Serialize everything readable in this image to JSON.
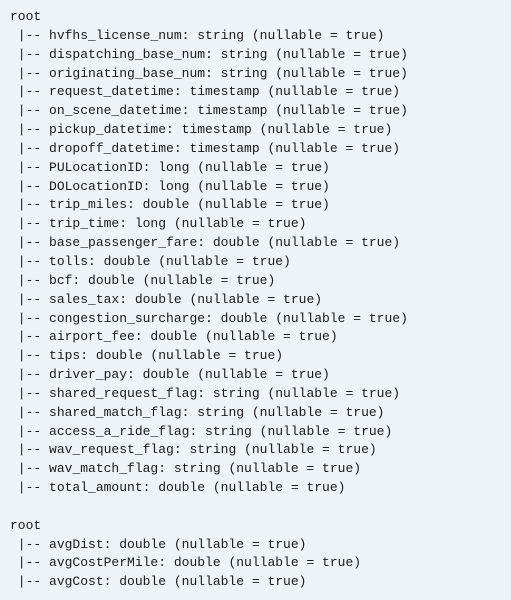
{
  "schemas": [
    {
      "label": "root",
      "fields": [
        {
          "name": "hvfhs_license_num",
          "type": "string",
          "nullable": true
        },
        {
          "name": "dispatching_base_num",
          "type": "string",
          "nullable": true
        },
        {
          "name": "originating_base_num",
          "type": "string",
          "nullable": true
        },
        {
          "name": "request_datetime",
          "type": "timestamp",
          "nullable": true
        },
        {
          "name": "on_scene_datetime",
          "type": "timestamp",
          "nullable": true
        },
        {
          "name": "pickup_datetime",
          "type": "timestamp",
          "nullable": true
        },
        {
          "name": "dropoff_datetime",
          "type": "timestamp",
          "nullable": true
        },
        {
          "name": "PULocationID",
          "type": "long",
          "nullable": true
        },
        {
          "name": "DOLocationID",
          "type": "long",
          "nullable": true
        },
        {
          "name": "trip_miles",
          "type": "double",
          "nullable": true
        },
        {
          "name": "trip_time",
          "type": "long",
          "nullable": true
        },
        {
          "name": "base_passenger_fare",
          "type": "double",
          "nullable": true
        },
        {
          "name": "tolls",
          "type": "double",
          "nullable": true
        },
        {
          "name": "bcf",
          "type": "double",
          "nullable": true
        },
        {
          "name": "sales_tax",
          "type": "double",
          "nullable": true
        },
        {
          "name": "congestion_surcharge",
          "type": "double",
          "nullable": true
        },
        {
          "name": "airport_fee",
          "type": "double",
          "nullable": true
        },
        {
          "name": "tips",
          "type": "double",
          "nullable": true
        },
        {
          "name": "driver_pay",
          "type": "double",
          "nullable": true
        },
        {
          "name": "shared_request_flag",
          "type": "string",
          "nullable": true
        },
        {
          "name": "shared_match_flag",
          "type": "string",
          "nullable": true
        },
        {
          "name": "access_a_ride_flag",
          "type": "string",
          "nullable": true
        },
        {
          "name": "wav_request_flag",
          "type": "string",
          "nullable": true
        },
        {
          "name": "wav_match_flag",
          "type": "string",
          "nullable": true
        },
        {
          "name": "total_amount",
          "type": "double",
          "nullable": true
        }
      ]
    },
    {
      "label": "root",
      "fields": [
        {
          "name": "avgDist",
          "type": "double",
          "nullable": true
        },
        {
          "name": "avgCostPerMile",
          "type": "double",
          "nullable": true
        },
        {
          "name": "avgCost",
          "type": "double",
          "nullable": true
        }
      ]
    }
  ]
}
